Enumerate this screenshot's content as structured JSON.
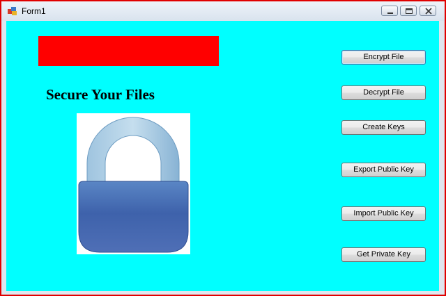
{
  "window": {
    "title": "Form1",
    "border_color": "#e00000",
    "client_background": "#00ffff",
    "icons": [
      "form-icon",
      "minimize-icon",
      "maximize-icon",
      "close-icon"
    ]
  },
  "main": {
    "banner_color": "#ff0000",
    "heading": "Secure Your Files",
    "image": "padlock-icon"
  },
  "buttons": {
    "encrypt": "Encrypt File",
    "decrypt": "Decrypt File",
    "create_keys": "Create Keys",
    "export_public": "Export Public Key",
    "import_public": "Import Public Key",
    "get_private": "Get Private Key"
  }
}
